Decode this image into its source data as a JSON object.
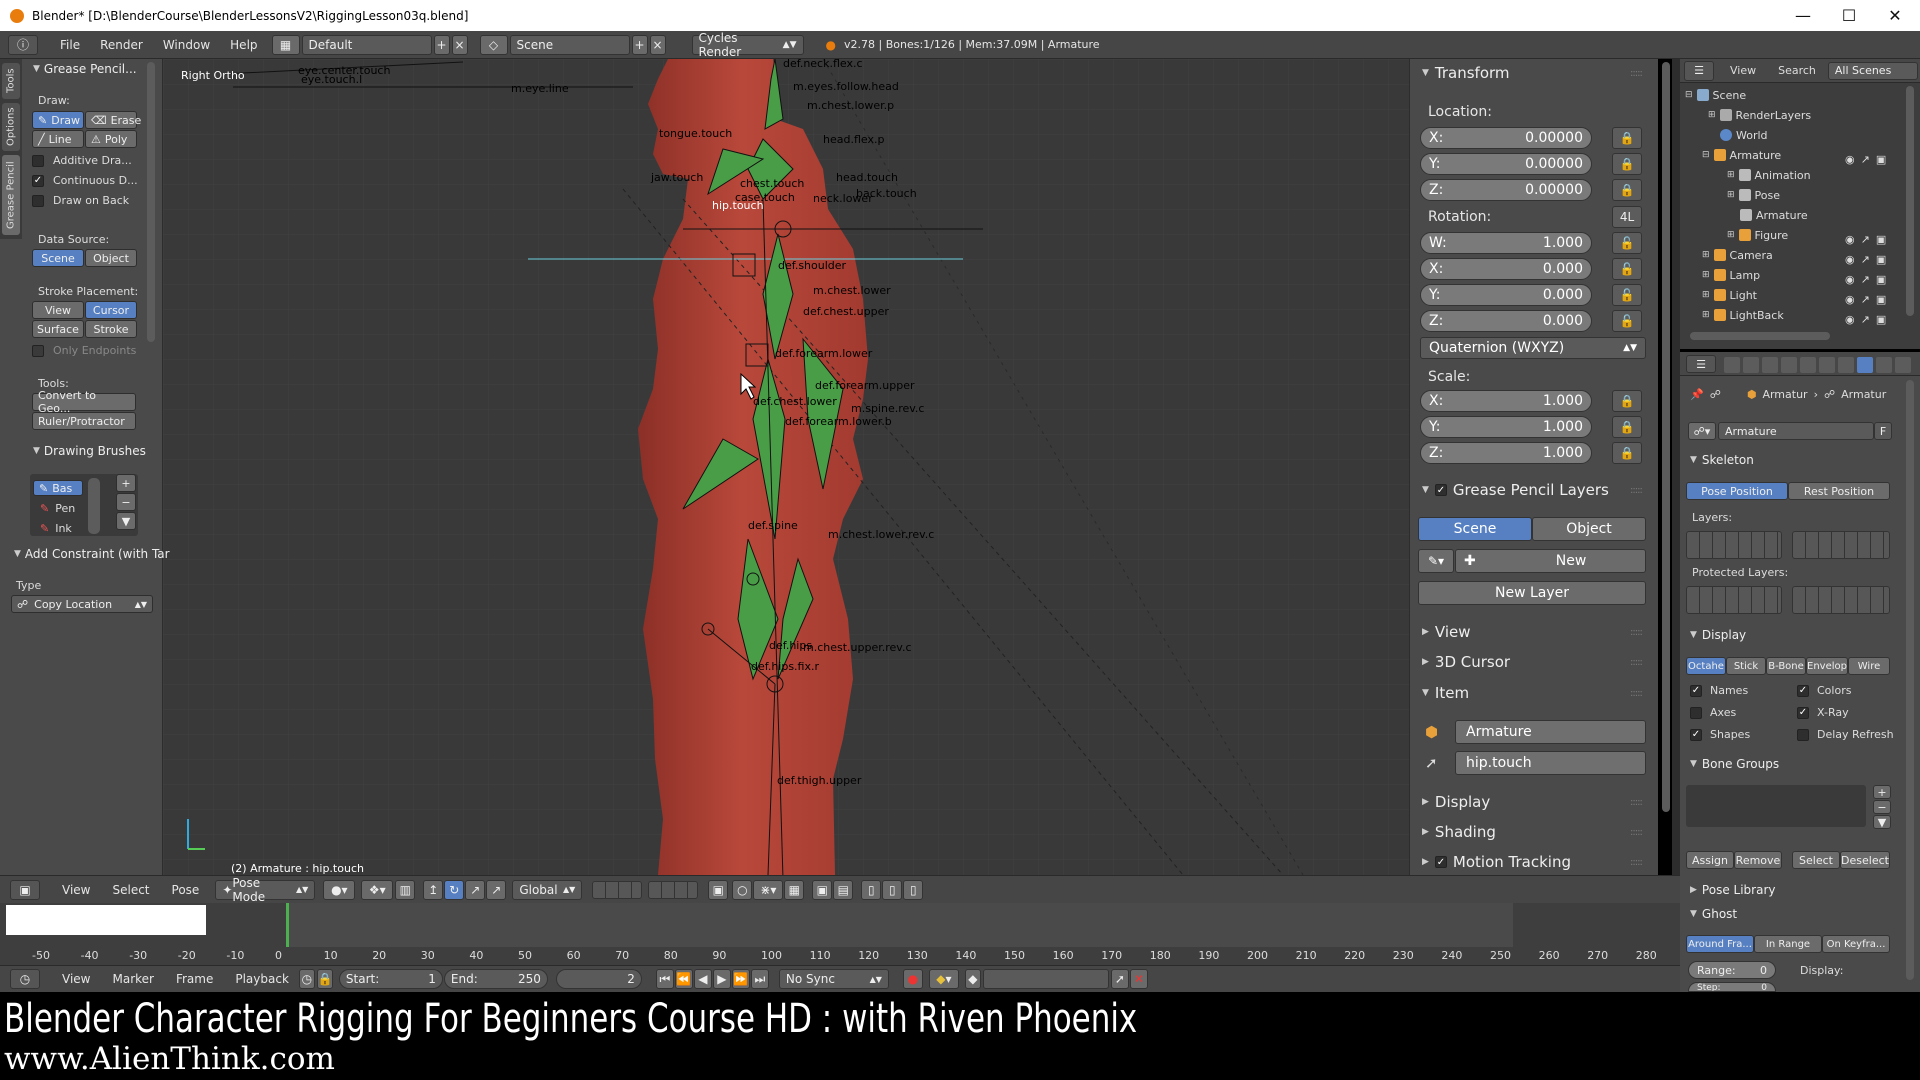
{
  "window": {
    "title": "Blender* [D:\\BlenderCourse\\BlenderLessonsV2\\RiggingLesson03q.blend]"
  },
  "info_header": {
    "menus": [
      "File",
      "Render",
      "Window",
      "Help"
    ],
    "layout": "Default",
    "scene": "Scene",
    "render_engine": "Cycles Render",
    "stats": "v2.78 | Bones:1/126 | Mem:37.09M | Armature"
  },
  "viewport": {
    "view_label": "Right Ortho",
    "status": "(2) Armature : hip.touch",
    "bone_labels": [
      "eye.touch.l",
      "eye.center.touch",
      "m.eye.line",
      "m.eyes.follow.head",
      "m.chest.lower.p",
      "tongue.touch",
      "head.flex.p",
      "jaw.touch",
      "chest.touch",
      "head.touch",
      "case.touch",
      "neck.lower",
      "back.touch",
      "hip.touch",
      "def.shoulder",
      "m.chest.lower",
      "def.chest.upper",
      "def.forearm.lower",
      "def.forearm.upper",
      "m.spine.rev.c",
      "def.chest.lower",
      "def.forearm.lower.b",
      "def.spine",
      "m.chest.lower.rev.c",
      "def.hips",
      "m.chest.upper.rev.c",
      "def.hips.fix.r",
      "def.thigh.upper",
      "def.neck.flex.c"
    ]
  },
  "toolshelf": {
    "tabs": [
      "Tools",
      "Options",
      "Grease Pencil"
    ],
    "grease_pencil_title": "Grease Pencil...",
    "draw_label": "Draw:",
    "draw_buttons": [
      "Draw",
      "Erase",
      "Line",
      "Poly"
    ],
    "checks": [
      {
        "label": "Additive Dra...",
        "checked": false
      },
      {
        "label": "Continuous D...",
        "checked": true
      },
      {
        "label": "Draw on Back",
        "checked": false
      }
    ],
    "data_source_label": "Data Source:",
    "data_source": [
      "Scene",
      "Object"
    ],
    "stroke_placement_label": "Stroke Placement:",
    "stroke_placement": [
      "View",
      "Cursor",
      "Surface",
      "Stroke"
    ],
    "only_endpoints": "Only Endpoints",
    "tools_label": "Tools:",
    "tools": [
      "Convert to Geo...",
      "Ruler/Protractor"
    ],
    "drawing_brushes_title": "Drawing Brushes",
    "brushes": [
      "Bas",
      "Pen",
      "Ink"
    ],
    "add_constraint_title": "Add Constraint (with Tar",
    "type_label": "Type",
    "type_value": "Copy Location"
  },
  "npanel": {
    "transform_title": "Transform",
    "location_label": "Location:",
    "location": [
      {
        "axis": "X:",
        "value": "0.00000"
      },
      {
        "axis": "Y:",
        "value": "0.00000"
      },
      {
        "axis": "Z:",
        "value": "0.00000"
      }
    ],
    "rotation_label": "Rotation:",
    "rotation_lock_label": "4L",
    "rotation": [
      {
        "axis": "W:",
        "value": "1.000"
      },
      {
        "axis": "X:",
        "value": "0.000"
      },
      {
        "axis": "Y:",
        "value": "0.000"
      },
      {
        "axis": "Z:",
        "value": "0.000"
      }
    ],
    "rotation_mode": "Quaternion (WXYZ)",
    "scale_label": "Scale:",
    "scale": [
      {
        "axis": "X:",
        "value": "1.000"
      },
      {
        "axis": "Y:",
        "value": "1.000"
      },
      {
        "axis": "Z:",
        "value": "1.000"
      }
    ],
    "gp_layers_title": "Grease Pencil Layers",
    "gp_layers_source": [
      "Scene",
      "Object"
    ],
    "new_label": "New",
    "new_layer_label": "New Layer",
    "view_title": "View",
    "cursor_title": "3D Cursor",
    "item_title": "Item",
    "item_object": "Armature",
    "item_bone": "hip.touch",
    "display_title": "Display",
    "shading_title": "Shading",
    "motion_tracking_title": "Motion Tracking"
  },
  "outliner": {
    "header": [
      "View",
      "Search",
      "All Scenes"
    ],
    "rows": [
      "Scene",
      "RenderLayers",
      "World",
      "Armature",
      "Animation",
      "Pose",
      "Armature",
      "Figure",
      "Camera",
      "Lamp",
      "Light",
      "LightBack"
    ]
  },
  "properties": {
    "breadcrumb": [
      "Armatur",
      "Armatur"
    ],
    "datablock": "Armature",
    "datablock_flag": "F",
    "skeleton_title": "Skeleton",
    "positions": [
      "Pose Position",
      "Rest Position"
    ],
    "layers_label": "Layers:",
    "protected_layers_label": "Protected Layers:",
    "display_title": "Display",
    "display_modes": [
      "Octahe",
      "Stick",
      "B-Bone",
      "Envelop",
      "Wire"
    ],
    "display_checks": [
      {
        "label": "Names",
        "checked": true
      },
      {
        "label": "Colors",
        "checked": true
      },
      {
        "label": "Axes",
        "checked": false
      },
      {
        "label": "X-Ray",
        "checked": true
      },
      {
        "label": "Shapes",
        "checked": true
      },
      {
        "label": "Delay Refresh",
        "checked": false
      }
    ],
    "bone_groups_title": "Bone Groups",
    "bone_group_buttons": [
      "Assign",
      "Remove",
      "Select",
      "Deselect"
    ],
    "pose_library_title": "Pose Library",
    "ghost_title": "Ghost",
    "ghost_modes": [
      "Around Fra...",
      "In Range",
      "On Keyfra..."
    ],
    "range_label": "Range:",
    "range_value": "0",
    "step_label": "Step:",
    "step_value": "0",
    "ghost_display_label": "Display:"
  },
  "view3d_header": {
    "menus": [
      "View",
      "Select",
      "Pose"
    ],
    "mode": "Pose Mode",
    "orientation": "Global"
  },
  "timeline": {
    "ticks": [
      "-50",
      "-40",
      "-30",
      "-20",
      "-10",
      "0",
      "10",
      "20",
      "30",
      "40",
      "50",
      "60",
      "70",
      "80",
      "90",
      "100",
      "110",
      "120",
      "130",
      "140",
      "150",
      "160",
      "170",
      "180",
      "190",
      "200",
      "210",
      "220",
      "230",
      "240",
      "250",
      "260",
      "270",
      "280"
    ],
    "menus": [
      "View",
      "Marker",
      "Frame",
      "Playback"
    ],
    "start_label": "Start:",
    "start": "1",
    "end_label": "End:",
    "end": "250",
    "current": "2",
    "sync": "No Sync"
  },
  "caption": {
    "line1": "Blender Character Rigging For Beginners Course HD : with Riven Phoenix",
    "line2": "www.AlienThink.com"
  },
  "colors": {
    "accent": "#5680c2",
    "bone_green": "#4a9d47",
    "skin": "#b0473a"
  }
}
